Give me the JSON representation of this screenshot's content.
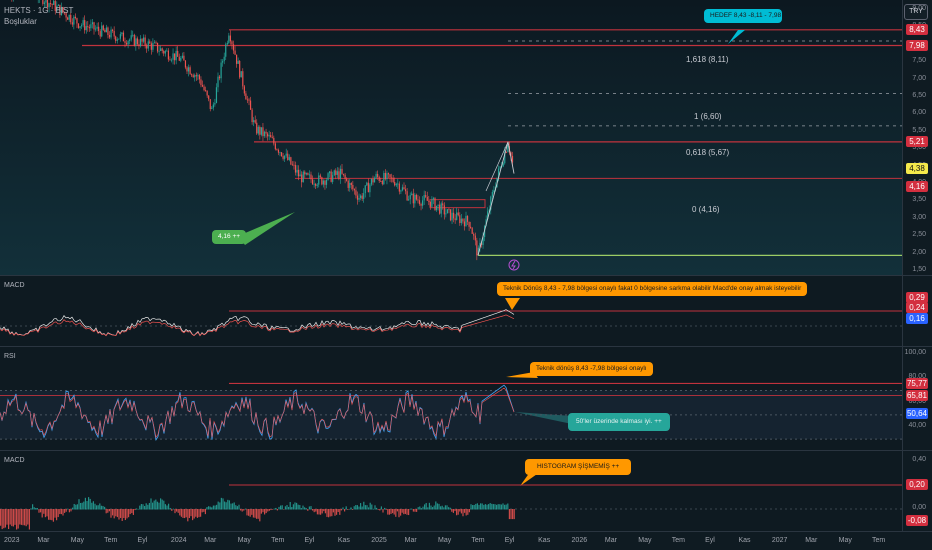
{
  "header": {
    "symbol_line": "HEKTS · 1G · BIST",
    "subtitle": "Boşluklar",
    "currency_button": "TRY"
  },
  "colors": {
    "bg": "#0f1b22",
    "bull": "#26a69a",
    "bear": "#ef5350",
    "line_red": "#c0333d",
    "line_green": "#9ccc65",
    "callout_blue": "#00bcd4",
    "callout_orange": "#ff9800",
    "callout_green": "#4caf50",
    "callout_teal": "#26a69a"
  },
  "price_axis": {
    "ticks": [
      "9,00",
      "8,50",
      "8,00",
      "7,50",
      "7,00",
      "6,50",
      "6,00",
      "5,50",
      "5,00",
      "4,50",
      "4,00",
      "3,50",
      "3,00",
      "2,50",
      "2,00",
      "1,50"
    ],
    "badges": [
      {
        "text": "8,43",
        "kind": "red"
      },
      {
        "text": "7,98",
        "kind": "red"
      },
      {
        "text": "5,21",
        "kind": "red"
      },
      {
        "text": "4,38",
        "kind": "yellow"
      },
      {
        "text": "4,16",
        "kind": "red"
      }
    ]
  },
  "fib_levels": [
    {
      "text": "1,618 (8,11)"
    },
    {
      "text": "1 (6,60)"
    },
    {
      "text": "0,618 (5,67)"
    },
    {
      "text": "0 (4,16)"
    }
  ],
  "callouts": {
    "target": "HEDEF 8,43 -8,11 - 7,98",
    "support": "4,16 ++",
    "macd_note": "Teknik Dönüş 8,43 - 7,98 bölgesi onaylı fakat 0 bölgesine sarkma olabilir Macd'de onay almak isteyebilir",
    "rsi_note": "Teknik dönüş  8,43 -7,98 bölgesi onaylı",
    "rsi_above": "50'ler üzerinde kalması iyi. ++",
    "histogram_note": "HISTOGRAM ŞİŞMEMİŞ ++"
  },
  "macd1": {
    "title": "MACD",
    "badges": [
      {
        "text": "0,29",
        "kind": "red"
      },
      {
        "text": "0,24",
        "kind": "red"
      },
      {
        "text": "0,16",
        "kind": "blue"
      }
    ]
  },
  "rsi": {
    "title": "RSI",
    "ticks": [
      "100,00",
      "80,00",
      "60,00",
      "40,00"
    ],
    "badges": [
      {
        "text": "75,77",
        "kind": "red"
      },
      {
        "text": "65,81",
        "kind": "red"
      },
      {
        "text": "50,64",
        "kind": "blue"
      }
    ]
  },
  "macd2": {
    "title": "MACD",
    "ticks": [
      "0,40",
      "0,20",
      "0,00"
    ],
    "badges": [
      {
        "text": "0,20",
        "kind": "red"
      },
      {
        "text": "-0,08",
        "kind": "red"
      }
    ]
  },
  "time_axis": [
    "2023",
    "Mar",
    "May",
    "Tem",
    "Eyl",
    "2024",
    "Mar",
    "May",
    "Tem",
    "Eyl",
    "Kas",
    "2025",
    "Mar",
    "May",
    "Tem",
    "Eyl",
    "Kas",
    "2026",
    "Mar",
    "May",
    "Tem",
    "Eyl",
    "Kas",
    "2027",
    "Mar",
    "May",
    "Tem"
  ]
}
